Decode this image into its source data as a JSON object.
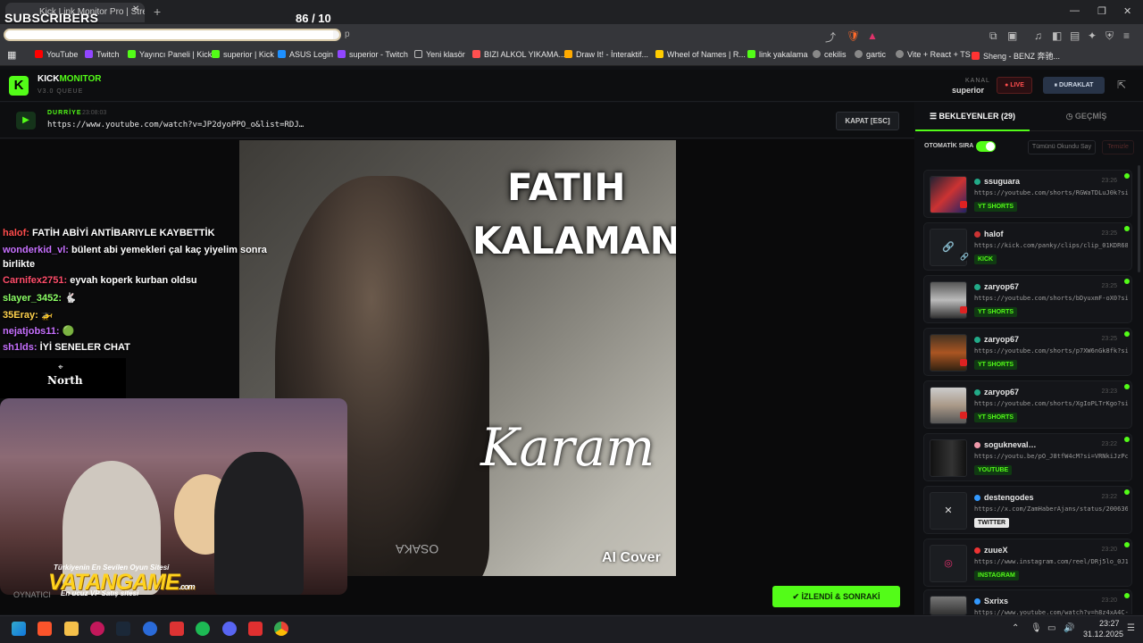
{
  "browser": {
    "tab_title": "Kick Link Monitor Pro | Stream",
    "url_tail": "p",
    "overlay_label": "SUBSCRIBERS",
    "overlay_count": "86  / 10",
    "progress_fraction": 0.98,
    "bookmarks": [
      {
        "label": "YouTube",
        "color": "#ff0000"
      },
      {
        "label": "Twitch",
        "color": "#9146ff"
      },
      {
        "label": "Yayıncı Paneli | Kick",
        "color": "#53fc18"
      },
      {
        "label": "superior | Kick",
        "color": "#53fc18"
      },
      {
        "label": "ASUS Login",
        "color": "#1e90ff"
      },
      {
        "label": "superior - Twitch",
        "color": "#9146ff"
      },
      {
        "label": "Yeni klasör",
        "color": "#bbbbbb"
      },
      {
        "label": "BIZI ALKOL YIKAMA...",
        "color": "#ff5050"
      },
      {
        "label": "Draw It! - İnteraktif...",
        "color": "#ffaa00"
      },
      {
        "label": "Wheel of Names | R...",
        "color": "#ffcc00"
      },
      {
        "label": "link yakalama",
        "color": "#53fc18"
      },
      {
        "label": "cekilis",
        "color": "#dddddd"
      },
      {
        "label": "gartic",
        "color": "#dddddd"
      },
      {
        "label": "Vite + React + TS",
        "color": "#dddddd"
      },
      {
        "label": "Sheng - BENZ 奔驰...",
        "color": "#ff3333"
      }
    ]
  },
  "app": {
    "brand_a": "KICK",
    "brand_b": "MONITOR",
    "version": "V3.0 QUEUE",
    "kanal_label": "KANAL",
    "kanal_value": "superior",
    "live_label": "LIVE",
    "pause_label": "DURAKLAT"
  },
  "current": {
    "user": "DURRİYE",
    "time": "23:08:03",
    "url": "https://www.youtube.com/watch?v=JP2dyoPPO_o&list=RDJ…",
    "close_label": "KAPAT [ESC]",
    "done_label": "İZLENDİ & SONRAKİ",
    "footer_label": "OYNATICI"
  },
  "video": {
    "title1": "FATIH",
    "title2": "KALAMAN",
    "script": "Karam",
    "tag": "AI Cover",
    "shirt": "OSAKA"
  },
  "chat": [
    {
      "user": "halof:",
      "msg": "FATİH ABİYİ ANTİBARIYLE KAYBETTİK",
      "color": "#ff4d4d"
    },
    {
      "user": "wonderkid_vl:",
      "msg": "bülent abi yemekleri çal kaç yiyelim sonra",
      "color": "#c770ff"
    },
    {
      "user": "",
      "msg": "birlikte",
      "color": "#ffffff"
    },
    {
      "user": "Carnifex2751:",
      "msg": "eyvah koperk kurban oldsu",
      "color": "#ff4d6a"
    },
    {
      "user": "slayer_3452:",
      "msg": "🐇",
      "color": "#8cff66"
    },
    {
      "user": "35Eray:",
      "msg": "🚁",
      "color": "#ffd24d"
    },
    {
      "user": "nejatjobs11:",
      "msg": "🟢",
      "color": "#c770ff"
    },
    {
      "user": "sh1lds:",
      "msg": "İYİ SENELER CHAT",
      "color": "#c770ff"
    }
  ],
  "overlay": {
    "north": "North",
    "vatan_top": "Türkiyenin En Sevilen Oyun Sitesi",
    "vatan_main": "VATANGAME",
    "vatan_com": ".com",
    "vatan_sub": "En ucuz VP Satış sitesi"
  },
  "sidebar": {
    "tab_waiting": "BEKLEYENLER (29)",
    "tab_history": "GEÇMİŞ",
    "auto_label": "OTOMATİK SIRA",
    "mark_all": "Tümünü Okundu Say",
    "clear": "Temizle",
    "items": [
      {
        "user": "ssuguara",
        "time": "23:26",
        "url": "https://youtube.com/shorts/RGWaTDLuJ0k?si…",
        "tag": "YT SHORTS",
        "kind": "yt"
      },
      {
        "user": "halof",
        "time": "23:25",
        "url": "https://kick.com/panky/clips/clip_01KDR68…",
        "tag": "KICK",
        "kind": "kick"
      },
      {
        "user": "zaryop67",
        "time": "23:25",
        "url": "https://youtube.com/shorts/bDyuxmF-oX0?si…",
        "tag": "YT SHORTS",
        "kind": "yt"
      },
      {
        "user": "zaryop67",
        "time": "23:25",
        "url": "https://youtube.com/shorts/p7XW6nGk8fk?si…",
        "tag": "YT SHORTS",
        "kind": "yt"
      },
      {
        "user": "zaryop67",
        "time": "23:23",
        "url": "https://youtube.com/shorts/XgIoPLTrKgo?si…",
        "tag": "YT SHORTS",
        "kind": "yt"
      },
      {
        "user": "sogukneval…",
        "time": "23:22",
        "url": "https://youtu.be/pO_J8tfW4cM?si=VRNkiJzPc…",
        "tag": "YOUTUBE",
        "kind": "yt"
      },
      {
        "user": "destengodes",
        "time": "23:22",
        "url": "https://x.com/ZamHaberAjans/status/200636…",
        "tag": "TWITTER",
        "kind": "x"
      },
      {
        "user": "zuueX",
        "time": "23:20",
        "url": "https://www.instagram.com/reel/DRj5lo_0J1…",
        "tag": "INSTAGRAM",
        "kind": "ig"
      },
      {
        "user": "Sxrixs",
        "time": "23:20",
        "url": "https://www.youtube.com/watch?v=h8z4xA4C-…",
        "tag": "",
        "kind": "yt"
      }
    ]
  },
  "taskbar": {
    "time": "23:27",
    "date": "31.12.2025"
  }
}
